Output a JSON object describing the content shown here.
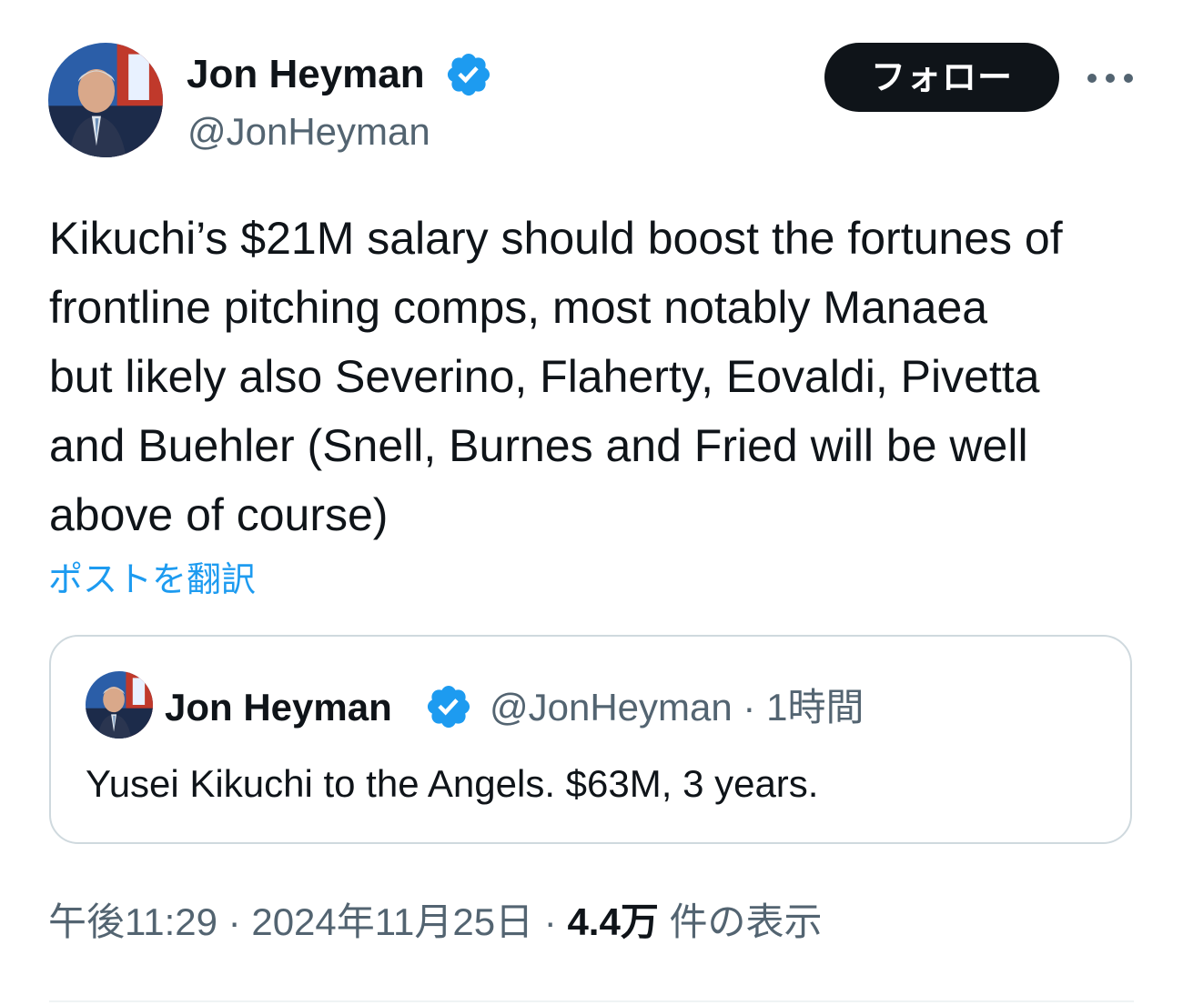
{
  "author": {
    "display_name": "Jon Heyman",
    "handle": "@JonHeyman",
    "avatar_icon": "avatar-photo",
    "verified_icon": "verified-badge-icon"
  },
  "header": {
    "follow_label": "フォロー",
    "more_icon": "more-options-icon"
  },
  "tweet": {
    "lines": [
      "Kikuchi’s $21M salary should boost the fortunes of",
      "frontline pitching comps, most notably Manaea",
      "but likely also Severino, Flaherty, Eovaldi, Pivetta",
      "and Buehler (Snell, Burnes and Fried will be well",
      "above of course)"
    ],
    "translate_label": "ポストを翻訳"
  },
  "quote": {
    "display_name": "Jon Heyman",
    "handle": "@JonHeyman",
    "separator": "·",
    "time": "1時間",
    "text": "Yusei Kikuchi to the Angels. $63M, 3 years."
  },
  "meta": {
    "time": "午後11:29",
    "separator": "·",
    "date": "2024年11月25日",
    "views_count": "4.4万",
    "views_label": "件の表示"
  },
  "colors": {
    "accent": "#1d9bf0",
    "text": "#0f1419",
    "secondary": "#536471",
    "border": "#cfd9de"
  }
}
